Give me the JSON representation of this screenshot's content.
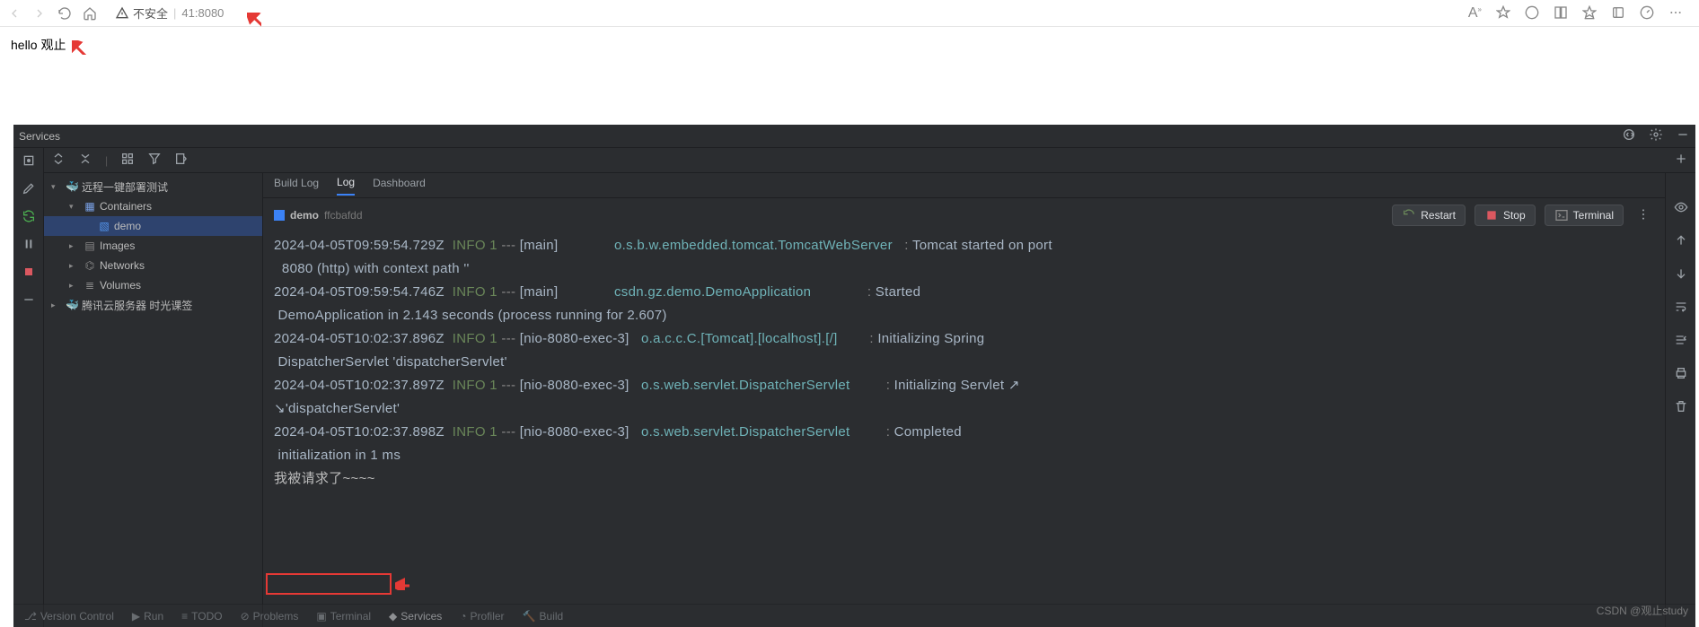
{
  "browser": {
    "url_label": "不安全",
    "url": "41:8080",
    "page_text": "hello 观止"
  },
  "ide": {
    "services_label": "Services",
    "sidebar": {
      "root": "远程一键部署测试",
      "containers": "Containers",
      "demo": "demo",
      "images": "Images",
      "networks": "Networks",
      "volumes": "Volumes",
      "tencent": "腾讯云服务器 时光课签"
    },
    "tabs": {
      "build_log": "Build Log",
      "log": "Log",
      "dashboard": "Dashboard"
    },
    "crumb": {
      "name": "demo",
      "hash": "ffcbafdd"
    },
    "actions": {
      "restart": "Restart",
      "stop": "Stop",
      "terminal": "Terminal"
    },
    "log_lines": [
      {
        "ts": "2024-04-05T09:59:54.729Z",
        "lvl": "INFO",
        "pid": "1",
        "thread": "main",
        "logger": "o.s.b.w.embedded.tomcat.TomcatWebServer",
        "msg": "Tomcat started on port"
      },
      {
        "cont": "  8080 (http) with context path ''"
      },
      {
        "ts": "2024-04-05T09:59:54.746Z",
        "lvl": "INFO",
        "pid": "1",
        "thread": "main",
        "logger": "csdn.gz.demo.DemoApplication",
        "msg": "Started"
      },
      {
        "cont": " DemoApplication in 2.143 seconds (process running for 2.607)"
      },
      {
        "ts": "2024-04-05T10:02:37.896Z",
        "lvl": "INFO",
        "pid": "1",
        "thread": "nio-8080-exec-3",
        "logger": "o.a.c.c.C.[Tomcat].[localhost].[/]",
        "msg": "Initializing Spring"
      },
      {
        "cont": " DispatcherServlet 'dispatcherServlet'"
      },
      {
        "ts": "2024-04-05T10:02:37.897Z",
        "lvl": "INFO",
        "pid": "1",
        "thread": "nio-8080-exec-3",
        "logger": "o.s.web.servlet.DispatcherServlet",
        "msg": "Initializing Servlet ↗"
      },
      {
        "cont": "↘'dispatcherServlet'"
      },
      {
        "ts": "2024-04-05T10:02:37.898Z",
        "lvl": "INFO",
        "pid": "1",
        "thread": "nio-8080-exec-3",
        "logger": "o.s.web.servlet.DispatcherServlet",
        "msg": "Completed"
      },
      {
        "cont": " initialization in 1 ms"
      },
      {
        "plain": "我被请求了~~~~"
      }
    ],
    "bottom": {
      "vc": "Version Control",
      "run": "Run",
      "todo": "TODO",
      "problems": "Problems",
      "terminal": "Terminal",
      "services": "Services",
      "profiler": "Profiler",
      "build": "Build"
    }
  },
  "watermark": "CSDN @观止study"
}
